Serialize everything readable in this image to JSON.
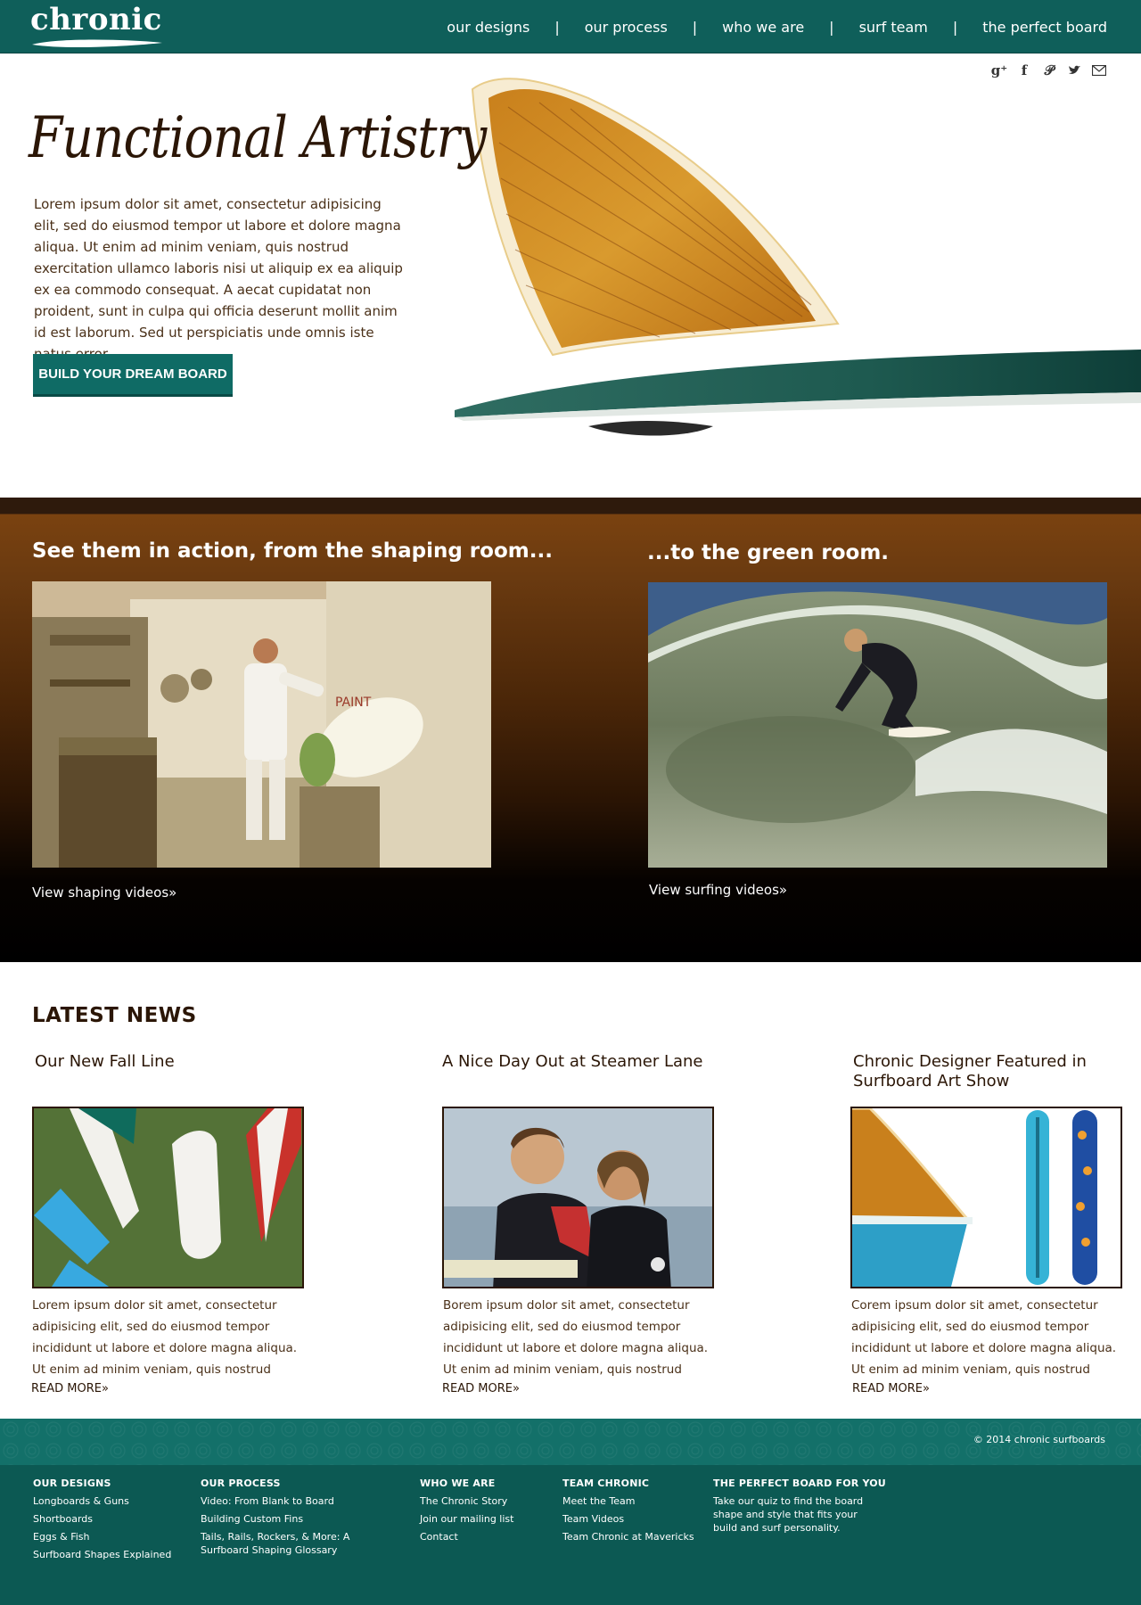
{
  "header": {
    "logo": "chronic",
    "nav": [
      "our designs",
      "our process",
      "who we are",
      "surf team",
      "the perfect board"
    ],
    "separator": "|"
  },
  "social": [
    "google-plus",
    "facebook",
    "pinterest",
    "twitter",
    "email"
  ],
  "hero": {
    "title": "Functional Artistry",
    "body": "Lorem ipsum dolor sit amet, consectetur adipisicing elit, sed do eiusmod tempor ut labore et dolore magna aliqua. Ut enim ad minim veniam, quis nostrud exercitation ullamco laboris nisi ut aliquip ex ea aliquip ex ea commodo consequat. A aecat cupidatat non proident, sunt in culpa qui officia deserunt mollit anim id est laborum. Sed ut perspiciatis unde omnis iste natus error",
    "cta": "BUILD YOUR DREAM BOARD"
  },
  "action": {
    "left_heading": "See them in action, from the shaping room...",
    "left_link": "View shaping videos»",
    "right_heading": "...to the green room.",
    "right_link": "View surfing videos»"
  },
  "news": {
    "heading": "LATEST NEWS",
    "items": [
      {
        "title": "Our New Fall Line",
        "excerpt": "Lorem ipsum dolor sit amet, consectetur adipisicing elit, sed do eiusmod tempor incididunt ut labore et dolore magna aliqua. Ut enim ad minim veniam, quis nostrud",
        "more": "READ MORE»"
      },
      {
        "title": "A Nice Day Out at Steamer Lane",
        "excerpt": "Borem ipsum dolor sit amet, consectetur adipisicing elit, sed do eiusmod tempor incididunt ut labore et dolore magna aliqua. Ut enim ad minim veniam, quis nostrud",
        "more": "READ MORE»"
      },
      {
        "title": "Chronic Designer Featured in Surfboard Art Show",
        "excerpt": "Corem ipsum dolor sit amet, consectetur adipisicing elit, sed do eiusmod tempor incididunt ut labore et dolore magna aliqua. Ut enim ad minim veniam, quis nostrud",
        "more": "READ MORE»"
      }
    ]
  },
  "footer": {
    "copyright": "© 2014 chronic surfboards",
    "columns": [
      {
        "title": "OUR DESIGNS",
        "links": [
          "Longboards & Guns",
          "Shortboards",
          "Eggs & Fish",
          "Surfboard Shapes Explained"
        ]
      },
      {
        "title": "OUR PROCESS",
        "links": [
          "Video: From Blank to Board",
          "Building Custom Fins",
          "Tails, Rails, Rockers, & More: A Surfboard Shaping Glossary"
        ]
      },
      {
        "title": "WHO WE ARE",
        "links": [
          "The Chronic Story",
          "Join our mailing list",
          "Contact"
        ]
      },
      {
        "title": "TEAM CHRONIC",
        "links": [
          "Meet the Team",
          "Team Videos",
          "Team Chronic at Mavericks"
        ]
      },
      {
        "title": "THE PERFECT BOARD FOR YOU",
        "text": "Take our quiz to find the board shape and style that fits your build and surf personality."
      }
    ]
  },
  "colors": {
    "teal": "#0f5f5a",
    "brown_dark": "#2b1606",
    "band_brown": "#7a4210",
    "footer": "#0c5953"
  }
}
